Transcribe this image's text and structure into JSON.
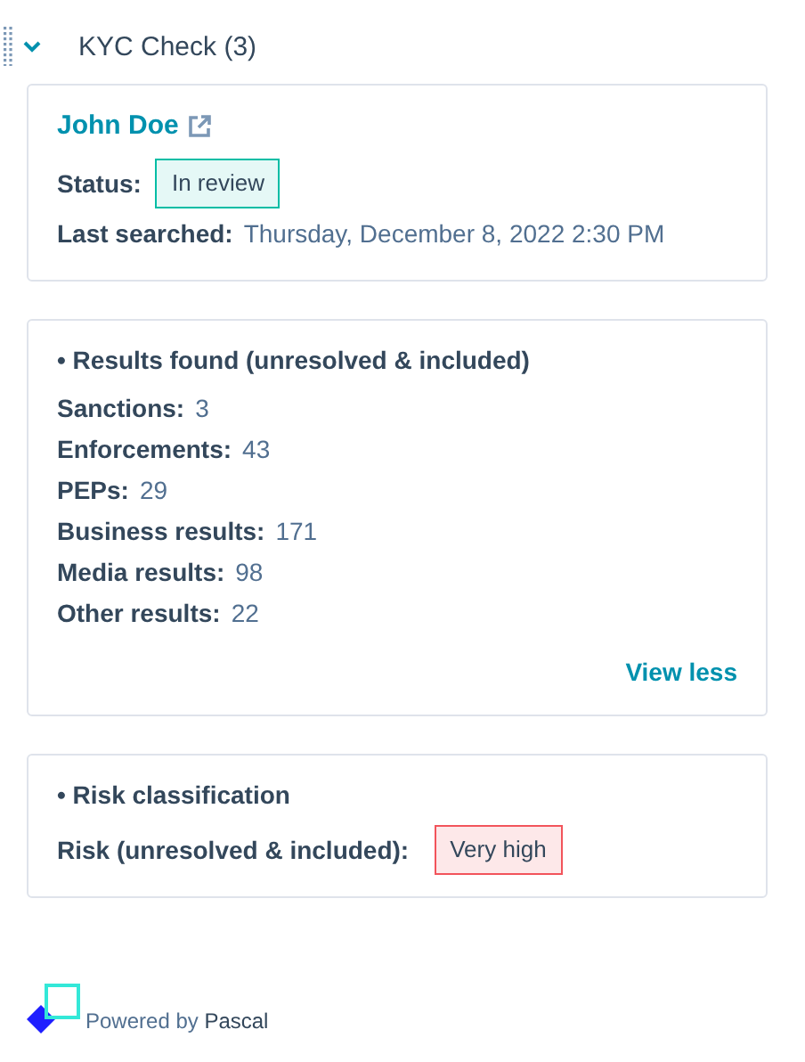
{
  "section": {
    "title": "KYC Check (3)",
    "expanded": true
  },
  "profile": {
    "name": "John Doe",
    "status_label": "Status:",
    "status": {
      "text": "In review",
      "kind": "info"
    },
    "last_label": "Last searched:",
    "last_value": "Thursday, December 8, 2022 2:30 PM"
  },
  "results": {
    "bullet": "•",
    "heading": "Results found (unresolved & included)",
    "rows": [
      {
        "label": "Sanctions:",
        "value": "3"
      },
      {
        "label": "Enforcements:",
        "value": "43"
      },
      {
        "label": "PEPs:",
        "value": "29"
      },
      {
        "label": "Business results:",
        "value": "171"
      },
      {
        "label": "Media results:",
        "value": "98"
      },
      {
        "label": "Other results:",
        "value": "22"
      }
    ],
    "toggle": "View less"
  },
  "risk": {
    "bullet": "•",
    "heading": "Risk classification",
    "label": "Risk (unresolved & included):",
    "tag": {
      "text": "Very high",
      "kind": "danger"
    }
  },
  "footer": "Powered by **Pascal**"
}
